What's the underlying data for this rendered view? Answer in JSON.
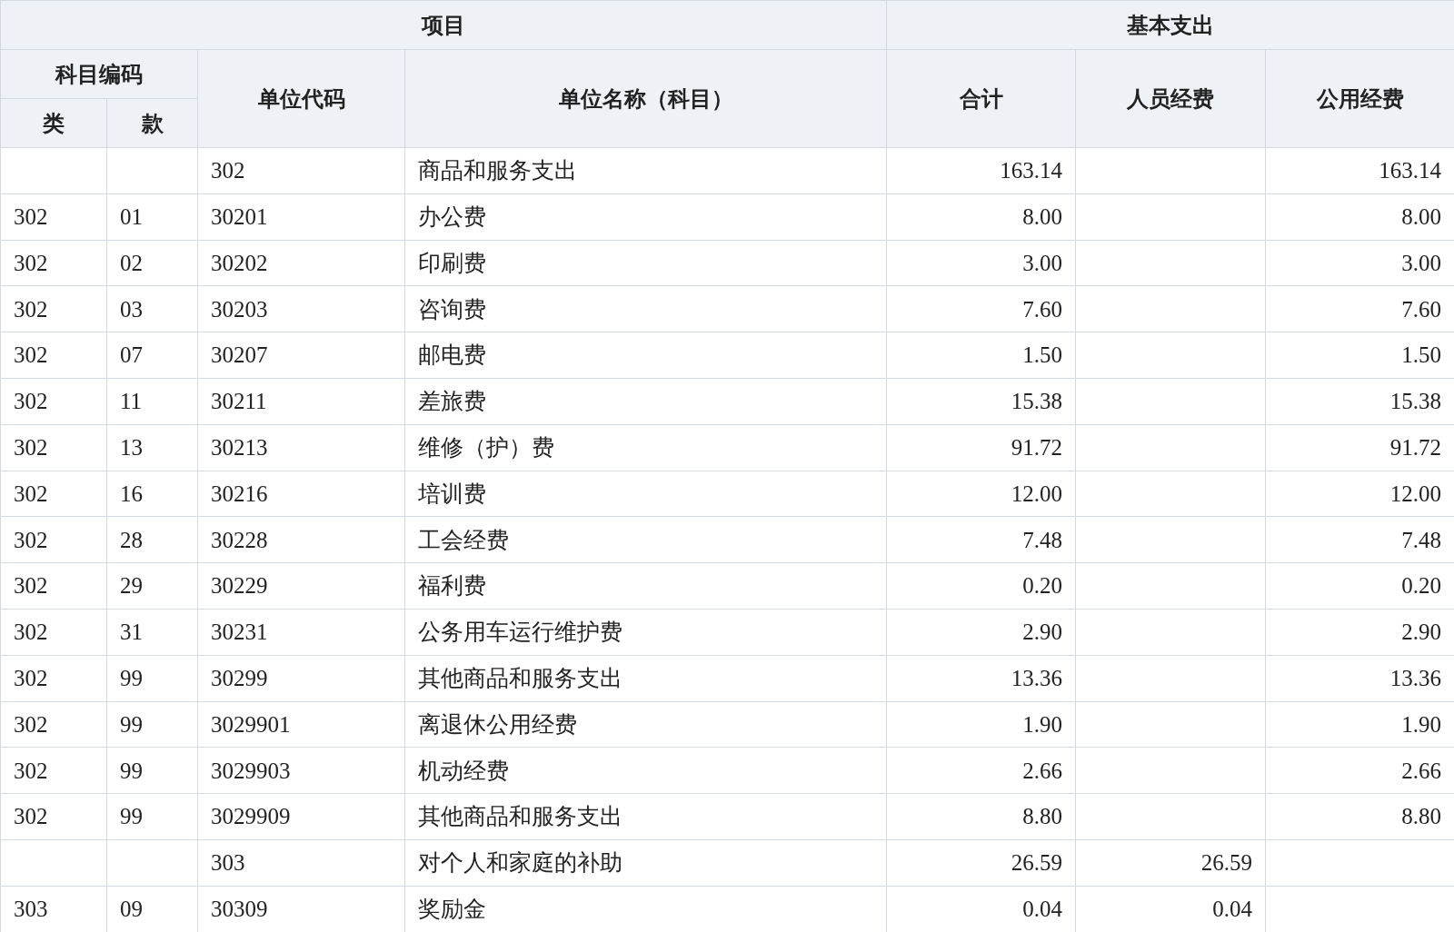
{
  "table": {
    "header": {
      "group_project": "项目",
      "group_basic": "基本支出",
      "subject_code": "科目编码",
      "class": "类",
      "section": "款",
      "unit_code": "单位代码",
      "unit_name": "单位名称（科目）",
      "total": "合计",
      "personnel": "人员经费",
      "public": "公用经费"
    },
    "rows": [
      {
        "code": "302",
        "name": "商品和服务支出",
        "total": "163.14",
        "public": "163.14"
      },
      {
        "class": "302",
        "section": "01",
        "code": "30201",
        "name": "办公费",
        "total": "8.00",
        "public": "8.00"
      },
      {
        "class": "302",
        "section": "02",
        "code": "30202",
        "name": "印刷费",
        "total": "3.00",
        "public": "3.00"
      },
      {
        "class": "302",
        "section": "03",
        "code": "30203",
        "name": "咨询费",
        "total": "7.60",
        "public": "7.60"
      },
      {
        "class": "302",
        "section": "07",
        "code": "30207",
        "name": "邮电费",
        "total": "1.50",
        "public": "1.50"
      },
      {
        "class": "302",
        "section": "11",
        "code": "30211",
        "name": "差旅费",
        "total": "15.38",
        "public": "15.38"
      },
      {
        "class": "302",
        "section": "13",
        "code": "30213",
        "name": "维修（护）费",
        "total": "91.72",
        "public": "91.72"
      },
      {
        "class": "302",
        "section": "16",
        "code": "30216",
        "name": "培训费",
        "total": "12.00",
        "public": "12.00"
      },
      {
        "class": "302",
        "section": "28",
        "code": "30228",
        "name": "工会经费",
        "total": "7.48",
        "public": "7.48"
      },
      {
        "class": "302",
        "section": "29",
        "code": "30229",
        "name": "福利费",
        "total": "0.20",
        "public": "0.20"
      },
      {
        "class": "302",
        "section": "31",
        "code": "30231",
        "name": "公务用车运行维护费",
        "total": "2.90",
        "public": "2.90"
      },
      {
        "class": "302",
        "section": "99",
        "code": "30299",
        "name": "其他商品和服务支出",
        "total": "13.36",
        "public": "13.36"
      },
      {
        "class": "302",
        "section": "99",
        "code": "3029901",
        "name": "离退休公用经费",
        "total": "1.90",
        "public": "1.90"
      },
      {
        "class": "302",
        "section": "99",
        "code": "3029903",
        "name": "机动经费",
        "total": "2.66",
        "public": "2.66"
      },
      {
        "class": "302",
        "section": "99",
        "code": "3029909",
        "name": "其他商品和服务支出",
        "total": "8.80",
        "public": "8.80"
      },
      {
        "code": "303",
        "name": "对个人和家庭的补助",
        "total": "26.59",
        "personnel": "26.59"
      },
      {
        "class": "303",
        "section": "09",
        "code": "30309",
        "name": "奖励金",
        "total": "0.04",
        "personnel": "0.04"
      }
    ]
  }
}
